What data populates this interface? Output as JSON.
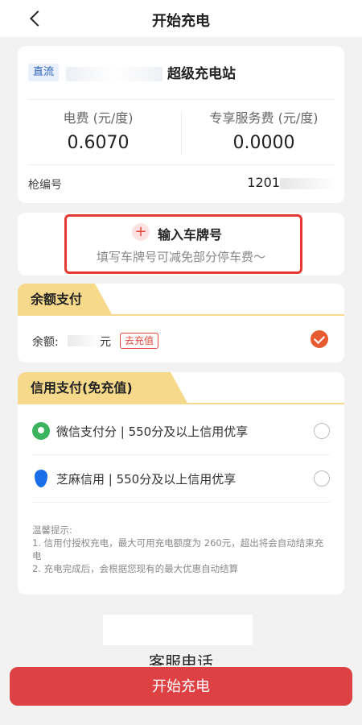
{
  "header": {
    "title": "开始充电"
  },
  "station": {
    "badge": "直流",
    "name": "超级充电站",
    "fee_label": "电费 (元/度)",
    "fee_value": "0.6070",
    "service_label": "专享服务费 (元/度)",
    "service_value": "0.0000",
    "gun_label": "枪编号",
    "gun_value": "1201"
  },
  "plate": {
    "title": "输入车牌号",
    "subtitle": "填写车牌号可减免部分停车费～"
  },
  "balance": {
    "section_title": "余额支付",
    "label": "余额:",
    "unit": "元",
    "recharge": "去充值",
    "selected": true
  },
  "credit": {
    "section_title": "信用支付(免充值)",
    "options": [
      {
        "label": "微信支付分 | 550分及以上信用优享",
        "icon": "wechat-pay-score-icon"
      },
      {
        "label": "芝麻信用  | 550分及以上信用优享",
        "icon": "sesame-credit-icon"
      }
    ],
    "tips": [
      "温馨提示:",
      "1. 信用付授权充电，最大可用充电额度为 260元，超出将会自动结束充电",
      "2. 充电完成后，会根据您现有的最大优惠自动结算"
    ]
  },
  "service": {
    "text": "客服电话"
  },
  "footer": {
    "start_button": "开始充电"
  },
  "colors": {
    "primary": "#de4144",
    "accent": "#f6d98a",
    "badge": "#2f63b8"
  }
}
